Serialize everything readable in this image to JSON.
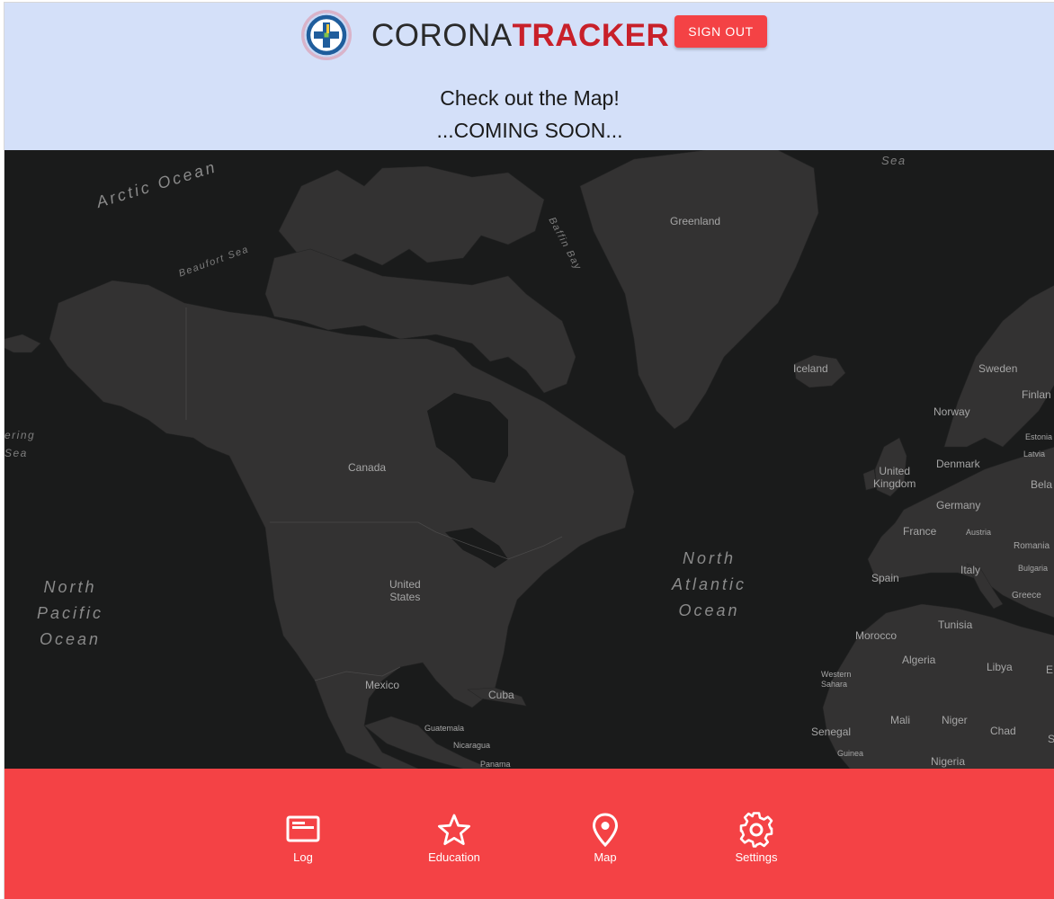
{
  "header": {
    "brand_part1": "CORONA",
    "brand_part2": "TRACKER",
    "signout_label": "SIGN OUT",
    "headline_1": "Check out the Map!",
    "headline_2": "...COMING SOON..."
  },
  "map": {
    "labels": {
      "arctic_ocean": "Arctic Ocean",
      "beaufort_sea": "Beaufort Sea",
      "baffin_bay": "Baffin Bay",
      "sea_top": "Sea",
      "greenland": "Greenland",
      "iceland": "Iceland",
      "sweden": "Sweden",
      "finland": "Finlan",
      "norway": "Norway",
      "estonia": "Estonia",
      "latvia": "Latvia",
      "bering_sea_1": "ering",
      "bering_sea_2": "Sea",
      "canada": "Canada",
      "denmark": "Denmark",
      "united_kingdom": "United\nKingdom",
      "belarus": "Bela",
      "germany": "Germany",
      "austria": "Austria",
      "france": "France",
      "romania": "Romania",
      "north_atlantic_ocean": "North\nAtlantic\nOcean",
      "north_pacific_ocean": "North\nPacific\nOcean",
      "united_states": "United\nStates",
      "spain": "Spain",
      "italy": "Italy",
      "bulgaria": "Bulgaria",
      "greece": "Greece",
      "tunisia": "Tunisia",
      "morocco": "Morocco",
      "algeria": "Algeria",
      "libya": "Libya",
      "egypt": "E",
      "western_sahara": "Western\nSahara",
      "mexico": "Mexico",
      "cuba": "Cuba",
      "mali": "Mali",
      "niger": "Niger",
      "chad": "Chad",
      "sudan": "S",
      "senegal": "Senegal",
      "guatemala": "Guatemala",
      "nicaragua": "Nicaragua",
      "guinea": "Guinea",
      "nigeria": "Nigeria",
      "panama": "Panama"
    }
  },
  "nav": {
    "items": [
      {
        "label": "Log",
        "icon": "log-icon"
      },
      {
        "label": "Education",
        "icon": "star-icon"
      },
      {
        "label": "Map",
        "icon": "map-pin-icon"
      },
      {
        "label": "Settings",
        "icon": "gear-icon"
      }
    ]
  },
  "colors": {
    "header_bg": "#d4e0f9",
    "accent_red": "#f44245",
    "brand_red": "#c8202a",
    "map_water": "#1a1b1b",
    "map_land": "#333232"
  }
}
